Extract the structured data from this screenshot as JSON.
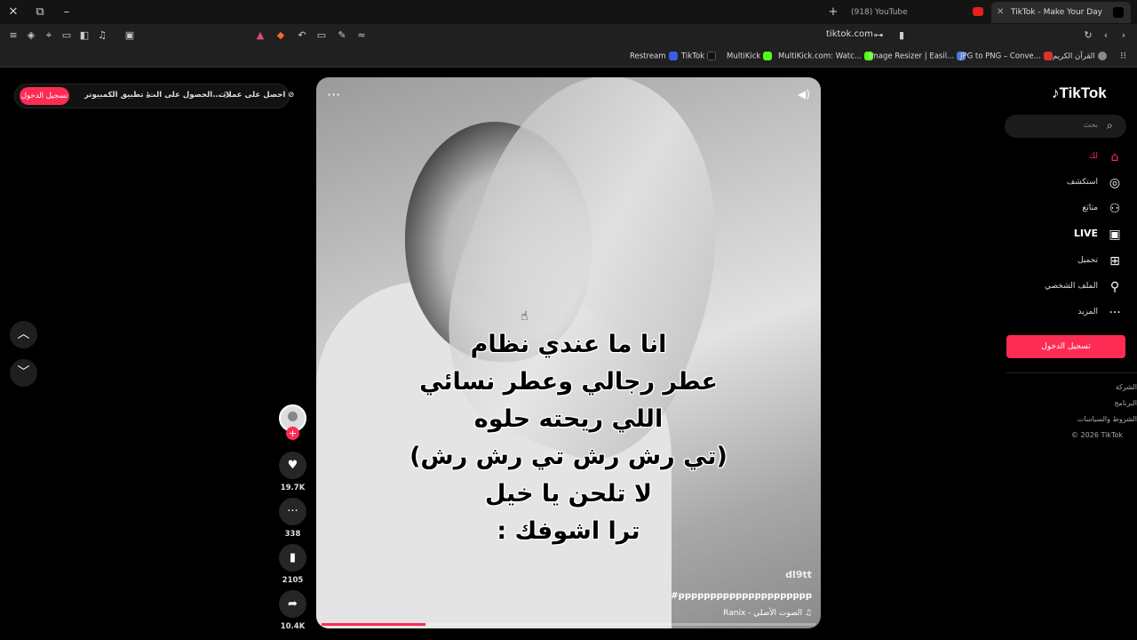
{
  "browser": {
    "tabs": [
      {
        "title": "(918) YouTube"
      },
      {
        "title": "TikTok - Make Your Day"
      }
    ],
    "url": "tiktok.com",
    "bookmarks": [
      {
        "label": "Restream"
      },
      {
        "label": "TikTok"
      },
      {
        "label": "MultiKick"
      },
      {
        "label": "MultiKick.com: Watc..."
      },
      {
        "label": "Image Resizer | Easil..."
      },
      {
        "label": "JPG to PNG – Conve..."
      },
      {
        "label": "القرآن الكريم"
      }
    ]
  },
  "topbar": {
    "coins": "احصل على عملات",
    "get_app": "الحصول على الت...",
    "desktop_app": "تطبيق الكمبيوتر",
    "login": "تسجيل الدخول"
  },
  "video": {
    "caption": [
      "انا ما عندي نظام",
      "عطر رجالي وعطر نسائي",
      "اللي ريحته حلوه",
      "(تي رش رش تي رش رش)",
      "لا تلحن يا خيل",
      "ترا اشوفك :"
    ],
    "watermark": "dl9tt",
    "hashtags": "#ppppppppppppppppppppp",
    "music": "الصوت الأصلي - Ranix",
    "progress": 0.21
  },
  "actions": {
    "likes": "19.7K",
    "comments": "338",
    "bookmarks": "2105",
    "shares": "10.4K"
  },
  "sidebar": {
    "logo": "TikTok",
    "search_placeholder": "بحث",
    "items": [
      {
        "label": "لك",
        "icon": "home-icon"
      },
      {
        "label": "استكشف",
        "icon": "compass-icon"
      },
      {
        "label": "متابَع",
        "icon": "user-plus-icon"
      },
      {
        "label": "LIVE",
        "icon": "live-tv-icon"
      },
      {
        "label": "تحميل",
        "icon": "upload-icon"
      },
      {
        "label": "الملف الشخصي",
        "icon": "profile-icon"
      },
      {
        "label": "المزيد",
        "icon": "more-icon"
      }
    ],
    "login_button": "تسجيل الدخول",
    "footer": [
      "الشركة",
      "البرنامج",
      "الشروط والسياسات",
      "© 2026 TikTok"
    ]
  },
  "colors": {
    "accent": "#fe2c55"
  }
}
